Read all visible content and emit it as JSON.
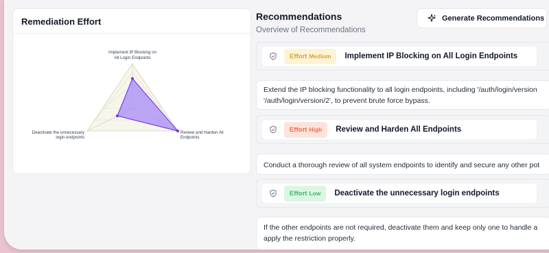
{
  "effort_panel": {
    "title": "Remediation Effort",
    "axes": [
      {
        "label_lines": [
          "Implement IP Blocking on",
          "All Login Endpoints"
        ]
      },
      {
        "label_lines": [
          "Review and Harden All",
          "Endpoints"
        ]
      },
      {
        "label_lines": [
          "Deactivate the unnecessary",
          "login endpoints"
        ]
      }
    ],
    "effort_values": [
      2,
      3,
      1
    ],
    "scale_max": 3,
    "fill_color": "#a78bfa",
    "stroke_color": "#7c3aed"
  },
  "recommendations": {
    "title": "Recommendations",
    "subtitle": "Overview of Recommendations",
    "generate_button": {
      "label": "Generate Recommendations",
      "icon": "sparkles-icon"
    },
    "items": [
      {
        "effort_prefix": "Effort",
        "effort_level": "Medium",
        "title": "Implement IP Blocking on All Login Endpoints",
        "description_lines": [
          "Extend the IP blocking functionality to all login endpoints, including '/auth/login/version",
          "'/auth/login/version/2', to prevent brute force bypass."
        ]
      },
      {
        "effort_prefix": "Effort",
        "effort_level": "High",
        "title": "Review and Harden All Endpoints",
        "description_lines": [
          "Conduct a thorough review of all system endpoints to identify and secure any other pot"
        ]
      },
      {
        "effort_prefix": "Effort",
        "effort_level": "Low",
        "title": "Deactivate the unnecessary login endpoints",
        "description_lines": [
          "If the other endpoints are not required, deactivate them and keep only one to handle a",
          "apply the restriction properly."
        ]
      }
    ]
  }
}
